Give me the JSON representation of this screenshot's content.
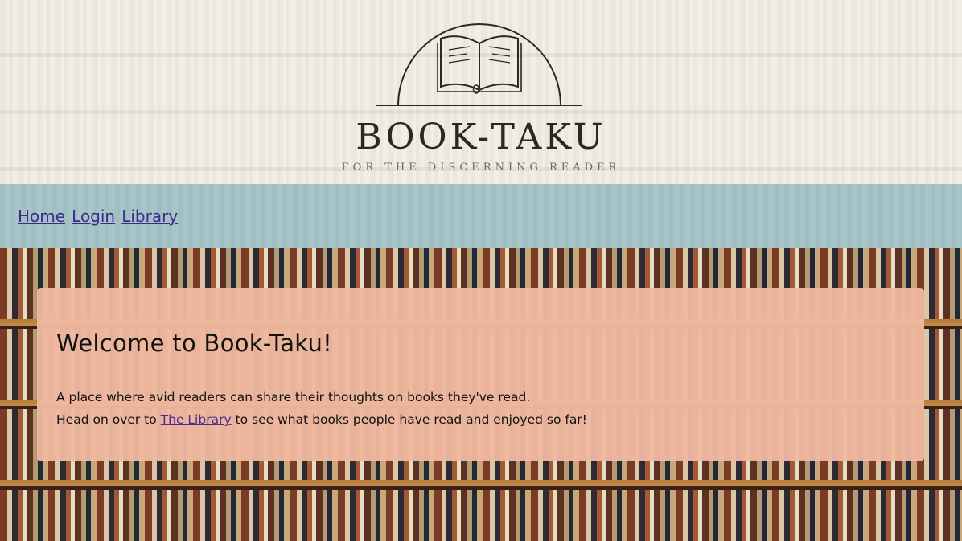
{
  "header": {
    "brand_name": "BOOK-TAKU",
    "tagline": "FOR THE DISCERNING READER",
    "logo_icon": "open-book-arch-icon"
  },
  "nav": {
    "links": [
      {
        "label": "Home"
      },
      {
        "label": "Login"
      },
      {
        "label": "Library"
      }
    ]
  },
  "welcome": {
    "heading": "Welcome to Book-Taku!",
    "line1": "A place where avid readers can share their thoughts on books they've read.",
    "line2_prefix": "Head on over to ",
    "line2_link": "The Library",
    "line2_suffix": " to see what books people have read and enjoyed so far!"
  },
  "colors": {
    "header_bg": "#f1eee6",
    "nav_bg": "#a7c4c8",
    "card_bg": "#eeb89f",
    "link": "#3b2a8a"
  }
}
